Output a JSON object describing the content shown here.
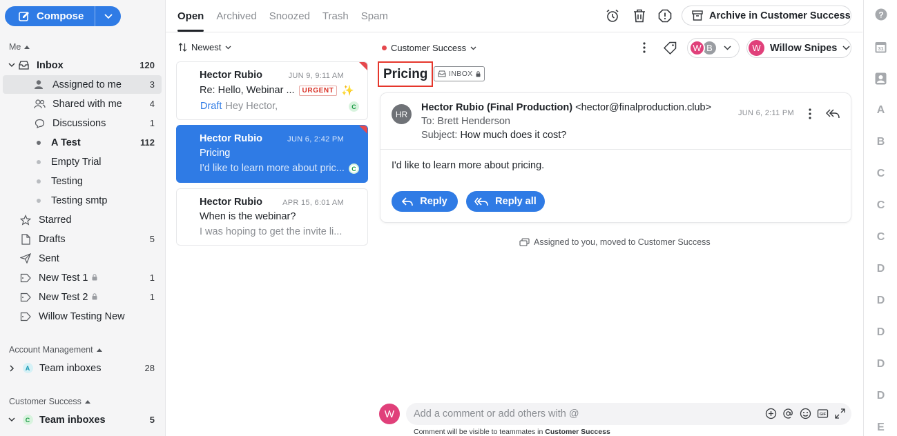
{
  "compose": {
    "label": "Compose"
  },
  "sidebar": {
    "me_label": "Me",
    "items": [
      {
        "label": "Inbox",
        "count": "120"
      },
      {
        "label": "Assigned to me",
        "count": "3"
      },
      {
        "label": "Shared with me",
        "count": "4"
      },
      {
        "label": "Discussions",
        "count": "1"
      },
      {
        "label": "A Test",
        "count": "112"
      },
      {
        "label": "Empty Trial",
        "count": ""
      },
      {
        "label": "Testing",
        "count": ""
      },
      {
        "label": "Testing smtp",
        "count": ""
      },
      {
        "label": "Starred",
        "count": ""
      },
      {
        "label": "Drafts",
        "count": "5"
      },
      {
        "label": "Sent",
        "count": ""
      },
      {
        "label": "New Test 1",
        "count": "1"
      },
      {
        "label": "New Test 2",
        "count": "1"
      },
      {
        "label": "Willow Testing New",
        "count": ""
      }
    ],
    "account_management": {
      "label": "Account Management",
      "team_inboxes": {
        "label": "Team inboxes",
        "badge": "A",
        "count": "28"
      }
    },
    "customer_success": {
      "label": "Customer Success",
      "team_inboxes": {
        "label": "Team inboxes",
        "badge": "C",
        "count": "5"
      }
    }
  },
  "tabs": [
    "Open",
    "Archived",
    "Snoozed",
    "Trash",
    "Spam"
  ],
  "toolbar": {
    "archive_label": "Archive in Customer Success"
  },
  "list": {
    "sort_label": "Newest",
    "messages": [
      {
        "from": "Hector Rubio",
        "date": "JUN 9, 9:11 AM",
        "subject": "Re: Hello, Webinar ...",
        "tag": "URGENT",
        "draft_label": "Draft",
        "preview": "Hey Hector,",
        "badge": "C"
      },
      {
        "from": "Hector Rubio",
        "date": "JUN 6, 2:42 PM",
        "subject": "Pricing",
        "preview": "I'd like to learn more about pric...",
        "badge": "C"
      },
      {
        "from": "Hector Rubio",
        "date": "APR 15, 6:01 AM",
        "subject": "When is the webinar?",
        "preview": "I was hoping to get the invite li..."
      }
    ]
  },
  "conversation": {
    "inbox_name": "Customer Success",
    "subject": "Pricing",
    "inbox_chip": "INBOX",
    "assignees": [
      "W",
      "B"
    ],
    "assignee_name": "Willow Snipes",
    "assignee_initial": "W",
    "message": {
      "avatar": "HR",
      "from_name": "Hector Rubio (Final Production)",
      "from_email": "<hector@finalproduction.club>",
      "to": "To: Brett Henderson",
      "subject_label": "Subject:",
      "subject": "How much does it cost?",
      "date": "JUN 6, 2:11 PM",
      "body": "I'd like to learn more about pricing.",
      "reply_label": "Reply",
      "reply_all_label": "Reply all"
    },
    "activity": "Assigned to you, moved to Customer Success",
    "comment": {
      "avatar": "W",
      "placeholder": "Add a comment or add others with @",
      "note_prefix": "Comment will be visible to teammates in",
      "note_inbox": "Customer Success"
    }
  },
  "rail": {
    "items": [
      "A",
      "B",
      "C",
      "C",
      "C",
      "D",
      "D",
      "D",
      "D",
      "D",
      "E"
    ]
  },
  "colors": {
    "accent": "#2f7be5",
    "urgent": "#d93025",
    "highlight_box": "#e5362b",
    "avatar_pink": "#e0407a",
    "avatar_gray": "#9a9da2",
    "avatar_dark": "#6f7277"
  }
}
